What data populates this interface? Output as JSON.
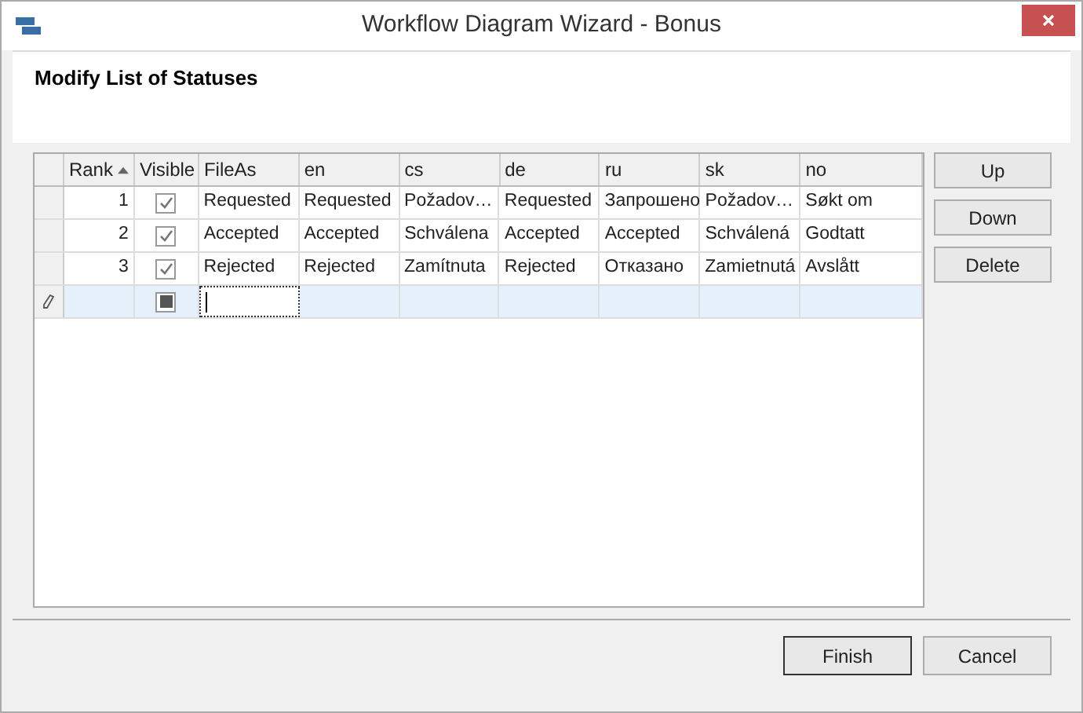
{
  "window": {
    "title": "Workflow Diagram Wizard - Bonus"
  },
  "header": {
    "title": "Modify List of Statuses"
  },
  "table": {
    "columns": [
      {
        "label": "Rank",
        "sorted": true
      },
      {
        "label": "Visible",
        "sorted": false
      },
      {
        "label": "FileAs",
        "sorted": false
      },
      {
        "label": "en",
        "sorted": false
      },
      {
        "label": "cs",
        "sorted": false
      },
      {
        "label": "de",
        "sorted": false
      },
      {
        "label": "ru",
        "sorted": false
      },
      {
        "label": "sk",
        "sorted": false
      },
      {
        "label": "no",
        "sorted": false
      }
    ],
    "rows": [
      {
        "checked": true,
        "cells": [
          "1",
          "",
          "Requested",
          "Requested",
          "Požadov…",
          "Requested",
          "Запрошено",
          "Požadov…",
          "Søkt om"
        ]
      },
      {
        "checked": true,
        "cells": [
          "2",
          "",
          "Accepted",
          "Accepted",
          "Schválena",
          "Accepted",
          "Accepted",
          "Schválená",
          "Godtatt"
        ]
      },
      {
        "checked": true,
        "cells": [
          "3",
          "",
          "Rejected",
          "Rejected",
          "Zamítnuta",
          "Rejected",
          "Отказано",
          "Zamietnutá",
          "Avslått"
        ]
      }
    ],
    "new_row": {
      "indeterminate": true
    }
  },
  "side_buttons": [
    "Up",
    "Down",
    "Delete"
  ],
  "footer_buttons": [
    {
      "label": "Finish",
      "default": true
    },
    {
      "label": "Cancel",
      "default": false
    }
  ]
}
